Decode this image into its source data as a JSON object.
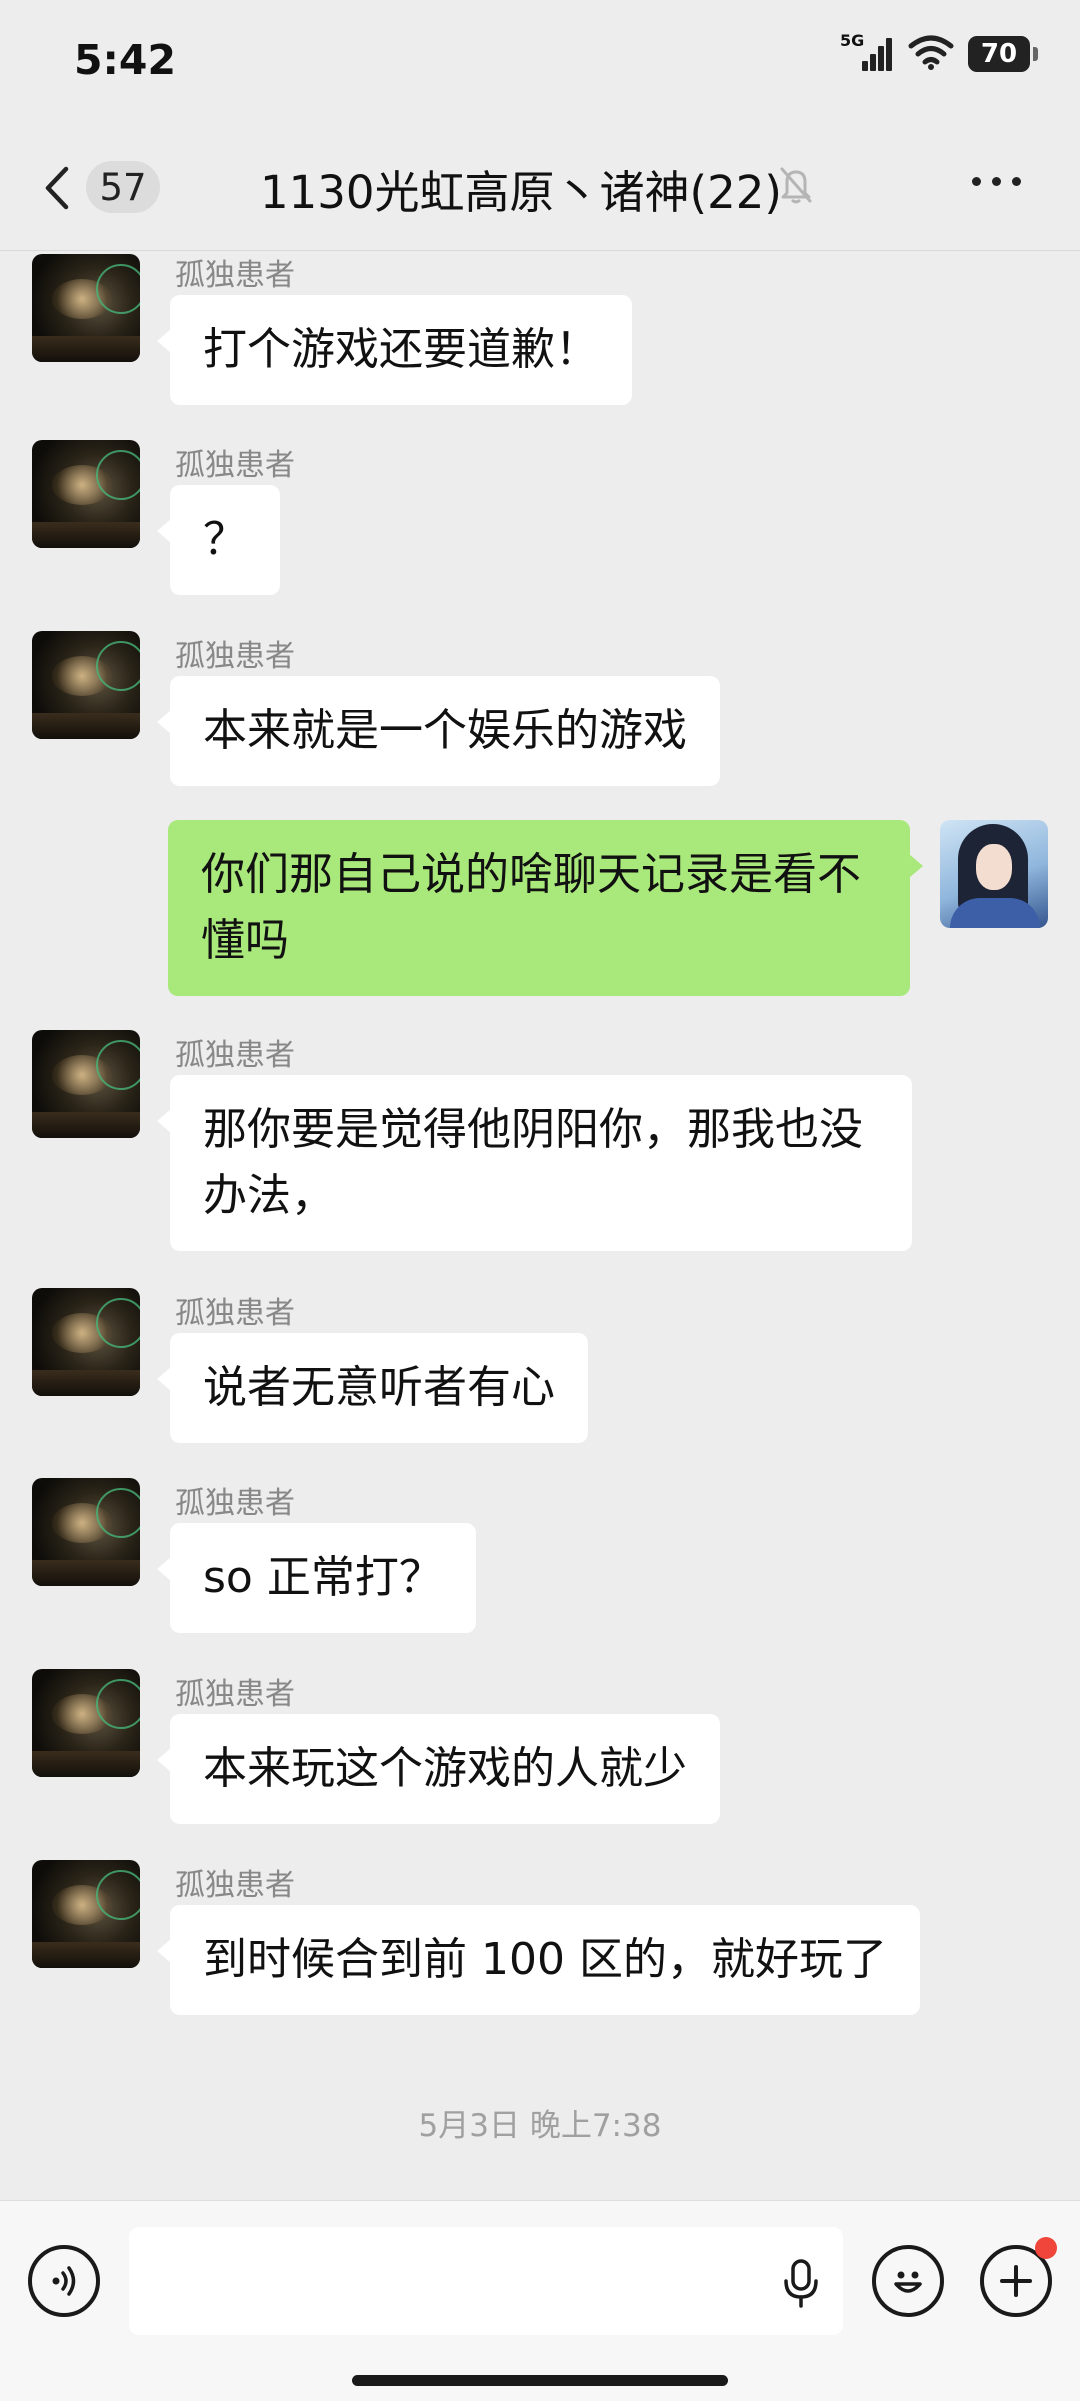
{
  "status_bar": {
    "time": "5:42",
    "network": "5G",
    "battery": "70"
  },
  "nav": {
    "back_count": "57",
    "title": "1130光虹高原丶诸神(22)"
  },
  "messages": [
    {
      "sender": "孤独患者",
      "text": "打个游戏还要道歉！"
    },
    {
      "sender": "孤独患者",
      "text": "？"
    },
    {
      "sender": "孤独患者",
      "text": "本来就是一个娱乐的游戏"
    },
    {
      "sender": "",
      "text": "你们那自己说的啥聊天记录是看不懂吗",
      "self": true
    },
    {
      "sender": "孤独患者",
      "text": "那你要是觉得他阴阳你，那我也没办法，"
    },
    {
      "sender": "孤独患者",
      "text": "说者无意听者有心"
    },
    {
      "sender": "孤独患者",
      "text": "so 正常打？"
    },
    {
      "sender": "孤独患者",
      "text": "本来玩这个游戏的人就少"
    },
    {
      "sender": "孤独患者",
      "text": "到时候合到前 100 区的，就好玩了"
    }
  ],
  "timestamp": "5月3日 晚上7:38",
  "icons": {
    "back": "chevron-left-icon",
    "mute": "bell-off-icon",
    "more": "more-dots-icon",
    "voice": "voice-icon",
    "mic": "mic-icon",
    "emoji": "emoji-icon",
    "plus": "plus-icon"
  },
  "colors": {
    "background": "#ededed",
    "self_bubble": "#a9e87b",
    "other_bubble": "#ffffff",
    "badge_dot": "#f0453a"
  }
}
